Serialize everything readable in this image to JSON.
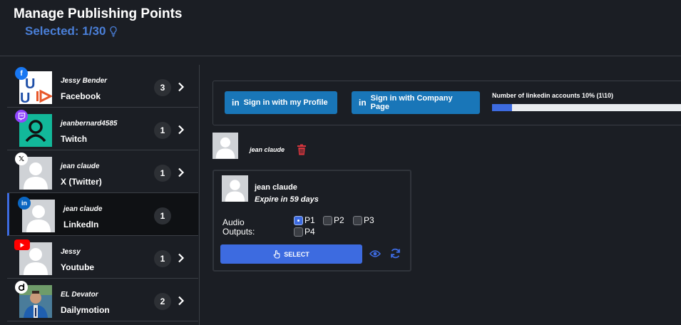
{
  "header": {
    "title": "Manage Publishing Points",
    "selected": "Selected: 1/30"
  },
  "sidebar": {
    "items": [
      {
        "username": "Jessy Bender",
        "platform": "Facebook",
        "count": "3"
      },
      {
        "username": "jeanbernard4585",
        "platform": "Twitch",
        "count": "1"
      },
      {
        "username": "jean claude",
        "platform": "X (Twitter)",
        "count": "1"
      },
      {
        "username": "jean claude",
        "platform": "LinkedIn",
        "count": "1"
      },
      {
        "username": "Jessy",
        "platform": "Youtube",
        "count": "1"
      },
      {
        "username": "EL Devator",
        "platform": "Dailymotion",
        "count": "2"
      }
    ]
  },
  "linkedin": {
    "sign_profile": "Sign in with my Profile",
    "sign_company": "Sign in with Company Page",
    "quota_label": "Number of linkedin accounts 10% (1\\10)",
    "quota_fraction": 0.1,
    "account_name": "jean claude"
  },
  "card": {
    "name": "jean claude",
    "expire": "Expire in 59 days",
    "audio_label": "Audio Outputs:",
    "outputs": [
      {
        "label": "P1",
        "checked": true
      },
      {
        "label": "P2",
        "checked": false
      },
      {
        "label": "P3",
        "checked": false
      },
      {
        "label": "P4",
        "checked": false
      }
    ],
    "select_label": "SELECT"
  },
  "colors": {
    "accent": "#3d6be0",
    "linkedin_button": "#1976b8",
    "background": "#1b1e24",
    "danger": "#d9363e"
  }
}
